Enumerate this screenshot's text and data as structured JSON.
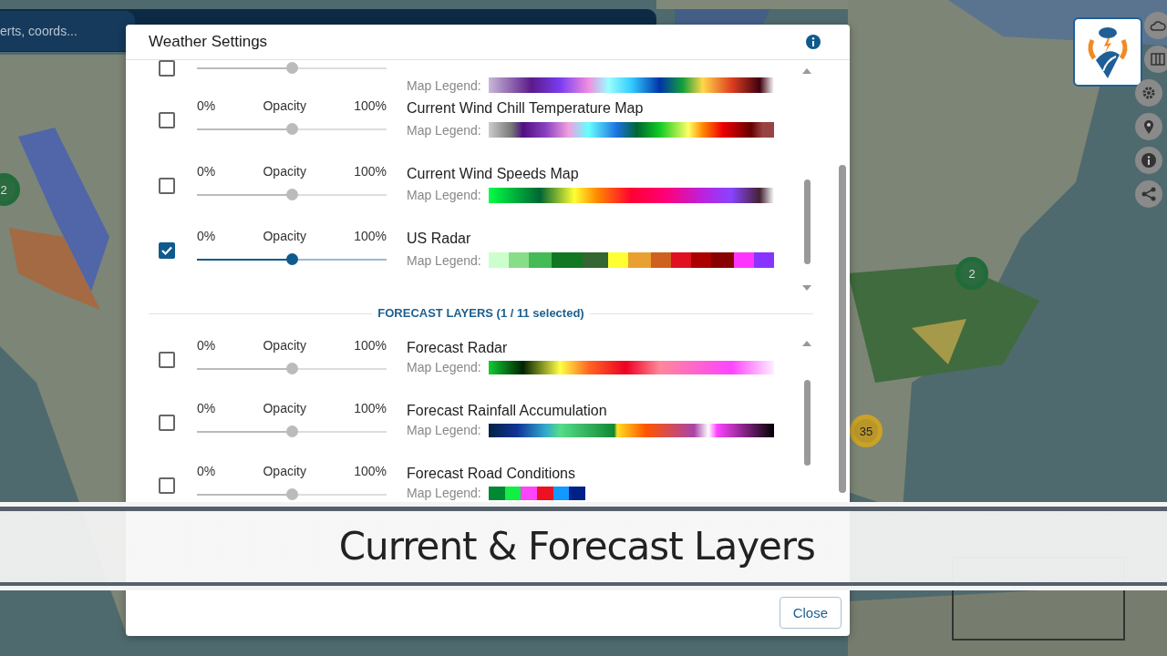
{
  "map": {
    "kind": "picture",
    "search": {
      "placeholder": "erts, coords..."
    },
    "clusters": [
      {
        "count": "2",
        "color": "#1f6b3a"
      },
      {
        "count": "2",
        "color": "#1f6b3a"
      },
      {
        "count": "35",
        "color": "#c9a227"
      }
    ]
  },
  "dialog": {
    "title": "Weather Settings",
    "current_layers": [
      {
        "kind": "partial",
        "checked": false,
        "level": 0.5,
        "legend_label": "Map Legend:"
      },
      {
        "kind": "full",
        "checked": false,
        "level": 0.5,
        "min": "0%",
        "label": "Opacity",
        "max": "100%",
        "title": "Current Wind Chill Temperature Map",
        "legend_label": "Map Legend:"
      },
      {
        "kind": "full",
        "checked": false,
        "level": 0.5,
        "min": "0%",
        "label": "Opacity",
        "max": "100%",
        "title": "Current Wind Speeds Map",
        "legend_label": "Map Legend:"
      },
      {
        "kind": "full",
        "checked": true,
        "level": 0.5,
        "min": "0%",
        "label": "Opacity",
        "max": "100%",
        "title": "US Radar",
        "legend_label": "Map Legend:"
      }
    ],
    "forecast_heading": "FORECAST LAYERS (1 / 11 selected)",
    "forecast_layers": [
      {
        "kind": "full",
        "checked": false,
        "level": 0.5,
        "min": "0%",
        "label": "Opacity",
        "max": "100%",
        "title": "Forecast Radar",
        "legend_label": "Map Legend:"
      },
      {
        "kind": "full",
        "checked": false,
        "level": 0.5,
        "min": "0%",
        "label": "Opacity",
        "max": "100%",
        "title": "Forecast Rainfall Accumulation",
        "legend_label": "Map Legend:"
      },
      {
        "kind": "full",
        "checked": false,
        "level": 0.5,
        "min": "0%",
        "label": "Opacity",
        "max": "100%",
        "title": "Forecast Road Conditions",
        "legend_label": "Map Legend:"
      }
    ],
    "close_button": "Close"
  },
  "caption": "Current & Forecast Layers"
}
